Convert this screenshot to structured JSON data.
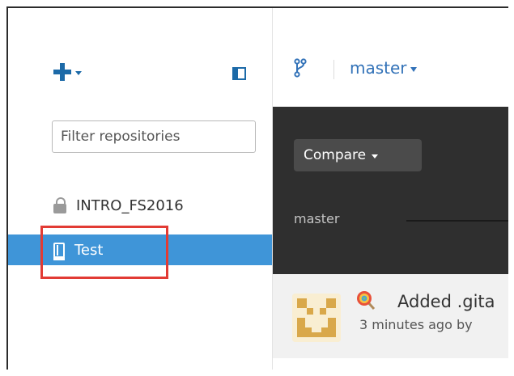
{
  "sidebar": {
    "add_icon": "plus-icon",
    "add_caret_icon": "chevron-down-icon",
    "panel_icon": "sidebar-toggle-icon",
    "filter": {
      "placeholder": "Filter repositories",
      "value": ""
    },
    "repositories": [
      {
        "name": "INTRO_FS2016",
        "icon": "lock-icon",
        "selected": false
      },
      {
        "name": "Test",
        "icon": "book-icon",
        "selected": true
      }
    ],
    "selection_color": "#3f95d8",
    "highlight_color": "#e23b34"
  },
  "toolbar": {
    "branch_icon": "git-branch-icon",
    "branch_name": "master"
  },
  "compare": {
    "button_label": "Compare",
    "timeline_label": "master"
  },
  "commit": {
    "emoji_icon": "lollipop-icon",
    "message": "Added .gita",
    "meta": "3 minutes ago by"
  },
  "colors": {
    "accent_blue": "#1c6aa8",
    "link_blue": "#3272b8",
    "dark_panel": "#2f2f2f"
  }
}
